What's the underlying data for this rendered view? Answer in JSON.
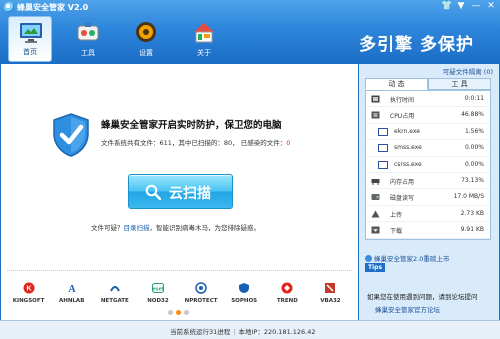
{
  "window": {
    "title": "蜂巢安全管家 V2.0",
    "controls": [
      "👕",
      "▼",
      "—",
      "✕"
    ]
  },
  "nav": [
    {
      "label": "首页",
      "icon": "monitor-icon",
      "active": true
    },
    {
      "label": "工具",
      "icon": "tools-icon",
      "active": false
    },
    {
      "label": "设置",
      "icon": "settings-icon",
      "active": false
    },
    {
      "label": "关于",
      "icon": "about-icon",
      "active": false
    }
  ],
  "slogan": "多引擎 多保护",
  "main": {
    "headline": "蜂巢安全管家开启实时防护，保卫您的电脑",
    "stats_prefix": "文件系统共有文件：611，其中已扫描的：80，  已感染的文件：",
    "infected_count": "0",
    "scan_button": "云扫描",
    "hint_prefix": "文件可疑？",
    "hint_link": "目录扫描",
    "hint_suffix": "，智能识别病毒木马，为您排除疑惑。"
  },
  "partners": [
    {
      "name": "KINGSOFT",
      "color": "#e2231a"
    },
    {
      "name": "AHNLAB",
      "color": "#1a5fb4"
    },
    {
      "name": "NETGATE",
      "color": "#1a5fb4"
    },
    {
      "name": "NOD32",
      "color": "#2aa06d"
    },
    {
      "name": "NPROTECT",
      "color": "#1a5fb4"
    },
    {
      "name": "SOPHOS",
      "color": "#1a5fb4"
    },
    {
      "name": "TREND",
      "color": "#e2231a"
    },
    {
      "name": "VBA32",
      "color": "#c0392b"
    }
  ],
  "pager": {
    "pages": 3,
    "active": 1
  },
  "right": {
    "quarantine_link": "可疑文件隔离 (0)",
    "tabs": [
      {
        "label": "动 态",
        "active": true
      },
      {
        "label": "工 具",
        "active": false
      }
    ],
    "rows": [
      {
        "label": "执行时间",
        "value": "0:0:11",
        "icon": "clock-icon",
        "sub": false
      },
      {
        "label": "CPU占用",
        "value": "46.88%",
        "icon": "cpu-icon",
        "sub": false
      },
      {
        "label": "ekrn.exe",
        "value": "1.56%",
        "icon": "process-icon",
        "sub": true
      },
      {
        "label": "smss.exe",
        "value": "0.00%",
        "icon": "process-icon",
        "sub": true
      },
      {
        "label": "csrss.exe",
        "value": "0.00%",
        "icon": "process-icon",
        "sub": true
      },
      {
        "label": "内存占用",
        "value": "73.13%",
        "icon": "memory-icon",
        "sub": false
      },
      {
        "label": "磁盘读写",
        "value": "17.0 MB/S",
        "icon": "disk-icon",
        "sub": false
      },
      {
        "label": "上传",
        "value": "2.73 KB",
        "icon": "upload-icon",
        "sub": false
      },
      {
        "label": "下载",
        "value": "9.91 KB",
        "icon": "download-icon",
        "sub": false
      }
    ],
    "promo": "蜂巢安全管家2.0重磅上市",
    "tips_badge": "Tips",
    "tips_text": "如果您在使用遇到问题，请到论坛提问",
    "tips_link": "蜂巢安全管家官方论坛"
  },
  "status": {
    "process_text": "当前系统运行31进程",
    "ip_text": "本地IP：220.181.126.42"
  },
  "colors": {
    "header_blue": "#2d86db",
    "accent_red": "#e0281c",
    "scan_button": "#23a6e4",
    "pager_active": "#ff8a17"
  }
}
